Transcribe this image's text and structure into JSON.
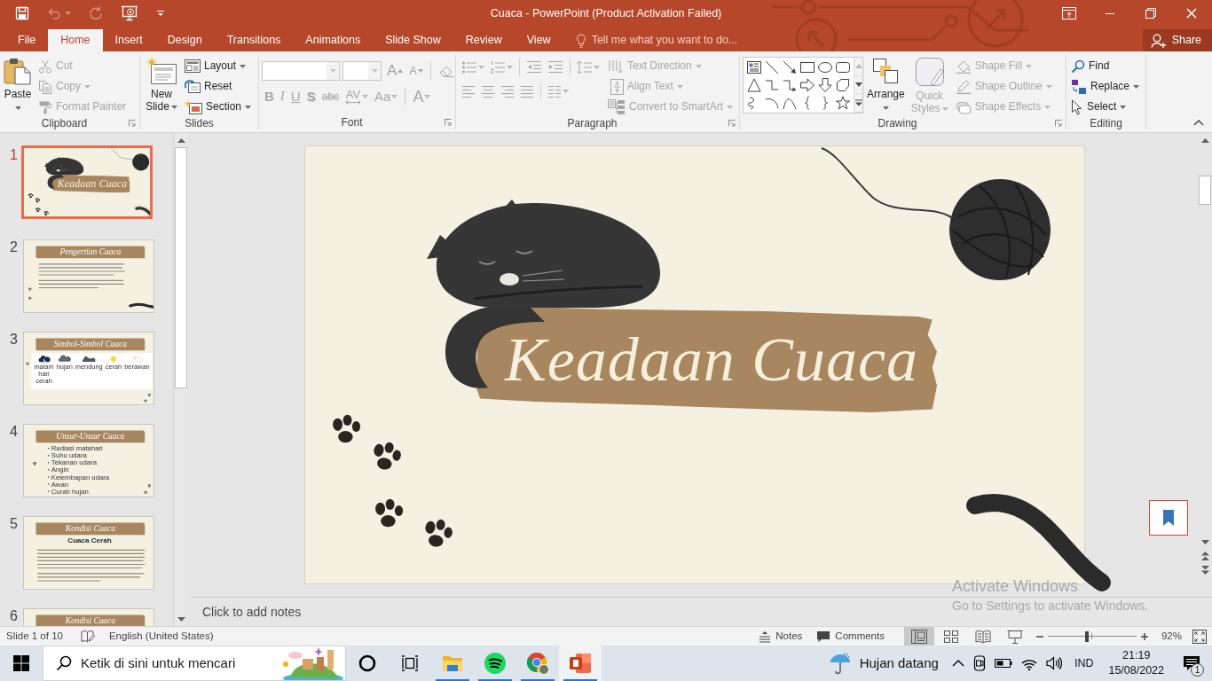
{
  "window": {
    "title": "Cuaca - PowerPoint (Product Activation Failed)"
  },
  "quick_access": [
    {
      "kind": "save",
      "disabled": false
    },
    {
      "kind": "undo",
      "disabled": true
    },
    {
      "kind": "redo",
      "disabled": true
    },
    {
      "kind": "present",
      "disabled": false
    },
    {
      "kind": "customize",
      "disabled": false
    }
  ],
  "tabs": [
    {
      "label": "File",
      "selected": false
    },
    {
      "label": "Home",
      "selected": true
    },
    {
      "label": "Insert",
      "selected": false
    },
    {
      "label": "Design",
      "selected": false
    },
    {
      "label": "Transitions",
      "selected": false
    },
    {
      "label": "Animations",
      "selected": false
    },
    {
      "label": "Slide Show",
      "selected": false
    },
    {
      "label": "Review",
      "selected": false
    },
    {
      "label": "View",
      "selected": false
    }
  ],
  "tell_me": {
    "placeholder": "Tell me what you want to do..."
  },
  "share": {
    "label": "Share"
  },
  "ribbon": [
    {
      "kind": "clipboard",
      "label": "Clipboard",
      "launcher": true,
      "large": [
        {
          "kind": "paste",
          "label": "Paste",
          "dropdown": true,
          "disabled": false
        }
      ],
      "items": [
        {
          "kind": "cut",
          "label": "Cut",
          "disabled": true
        },
        {
          "kind": "copy",
          "label": "Copy",
          "dropdown": true,
          "disabled": true
        },
        {
          "kind": "painter",
          "label": "Format Painter",
          "disabled": true
        }
      ]
    },
    {
      "kind": "slides",
      "label": "Slides",
      "large": [
        {
          "kind": "newslide",
          "label": "New Slide",
          "dropdown": true,
          "disabled": false
        }
      ],
      "items": [
        {
          "kind": "layout",
          "label": "Layout",
          "dropdown": true,
          "disabled": false
        },
        {
          "kind": "reset",
          "label": "Reset",
          "disabled": false
        },
        {
          "kind": "section",
          "label": "Section",
          "dropdown": true,
          "disabled": false
        }
      ]
    },
    {
      "kind": "font",
      "label": "Font",
      "launcher": true,
      "disabled": true,
      "tools": [
        {
          "kind": "grow",
          "label": "A"
        },
        {
          "kind": "shrink",
          "label": "A"
        },
        {
          "kind": "clear"
        },
        {
          "kind": "bold",
          "label": "B"
        },
        {
          "kind": "italic",
          "label": "I"
        },
        {
          "kind": "underline",
          "label": "U"
        },
        {
          "kind": "shadow",
          "label": "S"
        },
        {
          "kind": "strike",
          "label": "abc"
        },
        {
          "kind": "spacing",
          "label": "AV",
          "dropdown": true
        },
        {
          "kind": "case",
          "label": "Aa",
          "dropdown": true
        },
        {
          "kind": "color",
          "label": "A",
          "dropdown": true
        }
      ]
    },
    {
      "kind": "paragraph",
      "label": "Paragraph",
      "launcher": true,
      "disabled": true,
      "items": [
        {
          "kind": "textdir",
          "label": "Text Direction",
          "dropdown": true
        },
        {
          "kind": "aligntext",
          "label": "Align Text",
          "dropdown": true
        },
        {
          "kind": "smartart",
          "label": "Convert to SmartArt",
          "dropdown": true
        }
      ]
    },
    {
      "kind": "drawing",
      "label": "Drawing",
      "launcher": true,
      "large": [
        {
          "kind": "arrange",
          "label": "Arrange",
          "dropdown": true,
          "disabled": false
        },
        {
          "kind": "quickstyles",
          "label": "Quick Styles",
          "dropdown": true,
          "disabled": true
        }
      ],
      "items": [
        {
          "kind": "fill",
          "label": "Shape Fill",
          "dropdown": true,
          "disabled": true
        },
        {
          "kind": "outline",
          "label": "Shape Outline",
          "dropdown": true,
          "disabled": true
        },
        {
          "kind": "effects",
          "label": "Shape Effects",
          "dropdown": true,
          "disabled": true
        }
      ]
    },
    {
      "kind": "editing",
      "label": "Editing",
      "items": [
        {
          "kind": "find",
          "label": "Find",
          "disabled": false
        },
        {
          "kind": "replace",
          "label": "Replace",
          "dropdown": true,
          "disabled": false
        },
        {
          "kind": "select",
          "label": "Select",
          "dropdown": true,
          "disabled": false
        }
      ]
    }
  ],
  "slides": [
    {
      "number": "1",
      "selected": true,
      "kind": "cover",
      "title": "Keadaan Cuaca"
    },
    {
      "number": "2",
      "selected": false,
      "kind": "intro",
      "title": "Pengertian Cuaca"
    },
    {
      "number": "3",
      "selected": false,
      "kind": "symbols",
      "title": "Simbol-Simbol Cuaca",
      "symbols": [
        {
          "kind": "night",
          "label": "malam hari cerah"
        },
        {
          "kind": "rain",
          "label": "hujan"
        },
        {
          "kind": "cloudy",
          "label": "mendung"
        },
        {
          "kind": "sunny",
          "label": "cerah"
        },
        {
          "kind": "partly",
          "label": "berawan"
        }
      ]
    },
    {
      "number": "4",
      "selected": false,
      "kind": "bullets",
      "title": "Unsur-Unsur Cuaca",
      "items": [
        "Radiasi matahari",
        "Suhu udara",
        "Tekanan udara",
        "Angin",
        "Kelembapan udara",
        "Awan",
        "Curah hujan"
      ]
    },
    {
      "number": "5",
      "selected": false,
      "kind": "paragraphs",
      "title": "Kondisi Cuaca",
      "heading": "Cuaca Cerah"
    },
    {
      "number": "6",
      "selected": false,
      "kind": "band",
      "title": "Kondisi Cuaca"
    }
  ],
  "slide": {
    "kind": "cover",
    "title": "Keadaan Cuaca"
  },
  "notes": {
    "placeholder": "Click to add notes"
  },
  "activation": {
    "title": "Activate Windows",
    "message": "Go to Settings to activate Windows."
  },
  "status_bar": {
    "slide": "Slide 1 of 10",
    "language": "English (United States)",
    "notes": "Notes",
    "comments": "Comments",
    "views": [
      {
        "kind": "normal",
        "selected": true
      },
      {
        "kind": "sorter",
        "selected": false
      },
      {
        "kind": "reading",
        "selected": false
      },
      {
        "kind": "show",
        "selected": false
      }
    ],
    "zoom": {
      "level": 0.44,
      "reading": "92%"
    }
  },
  "taskbar": {
    "search": {
      "placeholder": "Ketik di sini untuk mencari"
    },
    "apps": [
      {
        "kind": "explorer",
        "running": true,
        "selected": false
      },
      {
        "kind": "spotify",
        "running": true,
        "selected": false
      },
      {
        "kind": "chrome",
        "running": true,
        "selected": false
      },
      {
        "kind": "powerpoint",
        "running": true,
        "selected": true
      }
    ],
    "weather": "Hujan datang",
    "language": "IND",
    "time": "21:19",
    "date": "15/08/2022",
    "notifications": "1"
  }
}
